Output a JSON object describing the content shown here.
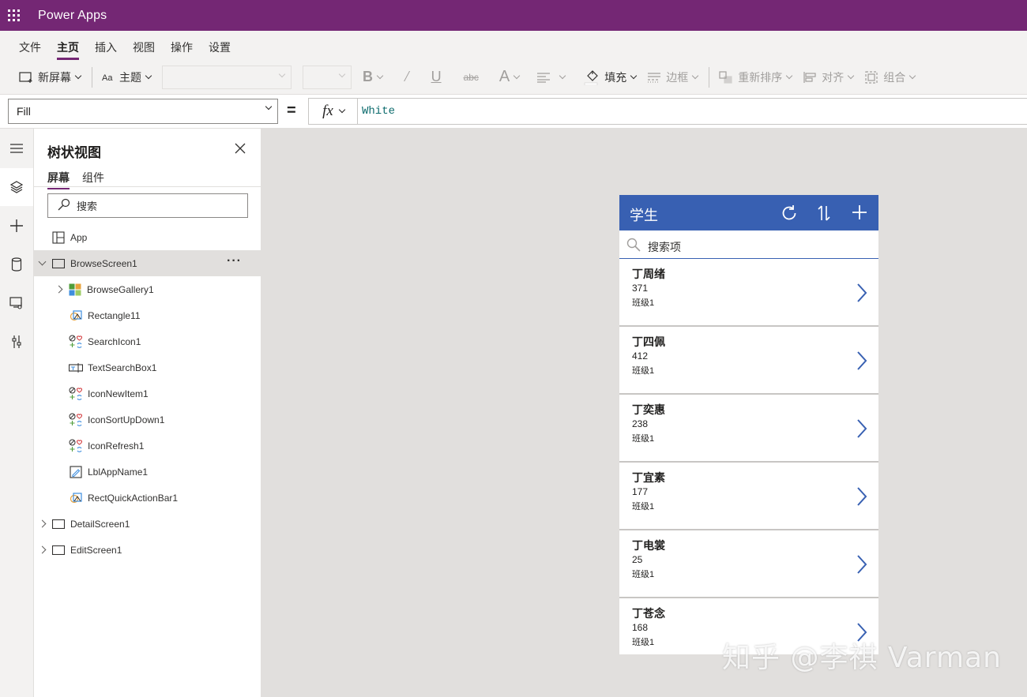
{
  "app": {
    "title": "Power Apps"
  },
  "menu": {
    "items": [
      "文件",
      "主页",
      "插入",
      "视图",
      "操作",
      "设置"
    ],
    "active": "主页"
  },
  "ribbon": {
    "new_screen": "新屏幕",
    "theme": "主题",
    "fill": "填充",
    "border": "边框",
    "reorder": "重新排序",
    "align": "对齐",
    "group": "组合"
  },
  "formula_bar": {
    "property": "Fill",
    "equals": "=",
    "fx": "fx",
    "formula": "White"
  },
  "tree": {
    "title": "树状视图",
    "tabs": [
      "屏幕",
      "组件"
    ],
    "search_placeholder": "搜索",
    "items": [
      {
        "label": "App",
        "icon": "app-icon"
      },
      {
        "label": "BrowseScreen1",
        "icon": "screen-icon",
        "selected": true,
        "expanded": true,
        "more": "···"
      },
      {
        "label": "BrowseGallery1",
        "icon": "gallery-icon"
      },
      {
        "label": "Rectangle11",
        "icon": "shape-icon"
      },
      {
        "label": "SearchIcon1",
        "icon": "icon-control-icon"
      },
      {
        "label": "TextSearchBox1",
        "icon": "textinput-icon"
      },
      {
        "label": "IconNewItem1",
        "icon": "icon-control-icon"
      },
      {
        "label": "IconSortUpDown1",
        "icon": "icon-control-icon"
      },
      {
        "label": "IconRefresh1",
        "icon": "icon-control-icon"
      },
      {
        "label": "LblAppName1",
        "icon": "label-icon"
      },
      {
        "label": "RectQuickActionBar1",
        "icon": "shape-icon"
      },
      {
        "label": "DetailScreen1",
        "icon": "screen-icon"
      },
      {
        "label": "EditScreen1",
        "icon": "screen-icon"
      }
    ]
  },
  "phone": {
    "title": "学生",
    "search_placeholder": "搜索项",
    "header_color": "#3860b2",
    "items": [
      {
        "name": "丁周绪",
        "number": "371",
        "class": "班级1"
      },
      {
        "name": "丁四佩",
        "number": "412",
        "class": "班级1"
      },
      {
        "name": "丁奕惠",
        "number": "238",
        "class": "班级1"
      },
      {
        "name": "丁宜素",
        "number": "177",
        "class": "班级1"
      },
      {
        "name": "丁电裳",
        "number": "25",
        "class": "班级1"
      },
      {
        "name": "丁苍念",
        "number": "168",
        "class": "班级1"
      }
    ]
  },
  "watermark": "知乎 @李祺 Varman",
  "colors": {
    "brand": "#742774",
    "accent": "#3860b2"
  }
}
